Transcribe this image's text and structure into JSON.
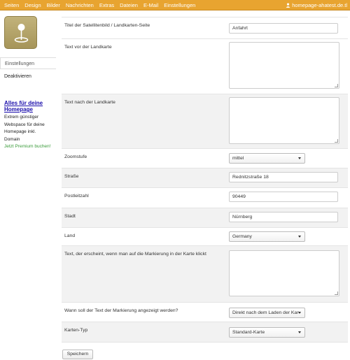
{
  "topnav": {
    "items": [
      "Seiten",
      "Design",
      "Bilder",
      "Nachrichten",
      "Extras",
      "Dateien",
      "E-Mail",
      "Einstellungen"
    ],
    "user": "homepage-ahatest.de.tl"
  },
  "sidebar": {
    "items": [
      "Einstellungen",
      "Deaktivieren"
    ],
    "promo": {
      "title_line1": "Alles für deine",
      "title_line2": "Homepage",
      "lines": [
        "Extrem günstiger",
        "Webspace für deine",
        "Homepage inkl.",
        "Domain"
      ],
      "link": "Jetzt Premium buchen!"
    }
  },
  "form": {
    "title_label": "Titel der Satellitenbild / Landkarten-Seite",
    "title_value": "Anfahrt",
    "text_before_label": "Text vor der Landkarte",
    "text_after_label": "Text nach der Landkarte",
    "zoom_label": "Zoomstufe",
    "zoom_value": "mittel",
    "street_label": "Straße",
    "street_value": "Rednitzstraße 18",
    "zip_label": "Postleitzahl",
    "zip_value": "90449",
    "city_label": "Stadt",
    "city_value": "Nürnberg",
    "country_label": "Land",
    "country_value": "Germany",
    "marker_text_label": "Text, der erscheint, wenn man auf die Markierung in der Karte klickt",
    "marker_when_label": "Wann soll der Text der Markierung angezeigt werden?",
    "marker_when_value": "Direkt nach dem Laden der Kar",
    "maptype_label": "Karten-Typ",
    "maptype_value": "Standard-Karte"
  },
  "save_label": "Speichern",
  "colors": {
    "topbar": "#e8a430",
    "promo_title": "#1a0dab",
    "promo_link": "#3a9b3a"
  }
}
